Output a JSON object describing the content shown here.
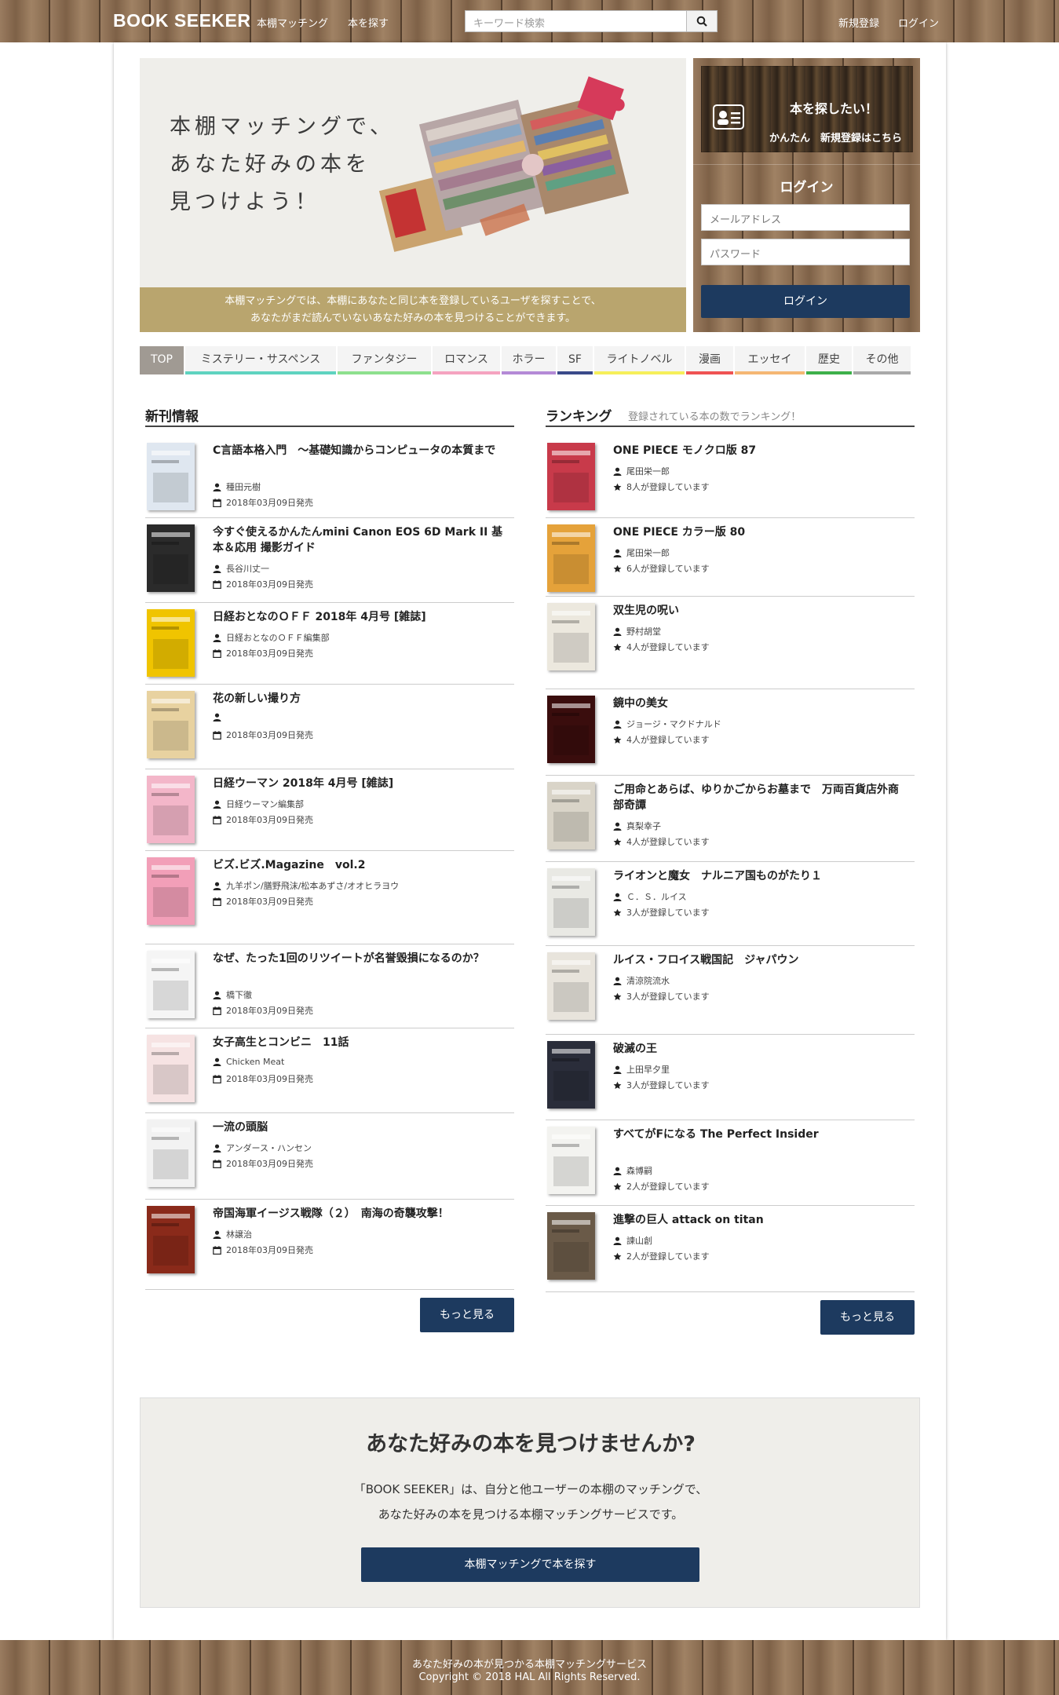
{
  "header": {
    "logo": "BOOK SEEKER",
    "nav": [
      "本棚マッチング",
      "本を探す"
    ],
    "search_placeholder": "キーワード検索",
    "register": "新規登録",
    "login": "ログイン"
  },
  "hero": {
    "title_lines": [
      "本棚マッチングで、",
      "あなた好みの本を",
      "見つけよう！"
    ],
    "bar_lines": [
      "本棚マッチングでは、本棚にあなたと同じ本を登録しているユーザを探すことで、",
      "あなたがまだ読んでいないあなた好みの本を見つけることができます。"
    ]
  },
  "side": {
    "promo_title": "本を探したい！",
    "promo_sub": "かんたん　新規登録はこちら",
    "login_title": "ログイン",
    "email_placeholder": "メールアドレス",
    "password_placeholder": "パスワード",
    "login_button": "ログイン"
  },
  "tabs": [
    {
      "label": "TOP",
      "color": "#a09a93"
    },
    {
      "label": "ミステリー・サスペンス",
      "color": "#5fd3c0"
    },
    {
      "label": "ファンタジー",
      "color": "#8ee08e"
    },
    {
      "label": "ロマンス",
      "color": "#f5a3c0"
    },
    {
      "label": "ホラー",
      "color": "#b48ad6"
    },
    {
      "label": "SF",
      "color": "#3a4a8a"
    },
    {
      "label": "ライトノベル",
      "color": "#f6ef5a"
    },
    {
      "label": "漫画",
      "color": "#ef5353"
    },
    {
      "label": "エッセイ",
      "color": "#f5b774"
    },
    {
      "label": "歴史",
      "color": "#3db04a"
    },
    {
      "label": "その他",
      "color": "#a9a9a9"
    }
  ],
  "new_releases": {
    "title": "新刊情報",
    "items": [
      {
        "title": "C言語本格入門　～基礎知識からコンピュータの本質まで",
        "author": "種田元樹",
        "date": "2018年03月09日発売",
        "cover": "#dfe7f0"
      },
      {
        "title": "今すぐ使えるかんたんmini Canon EOS 6D Mark II 基本＆応用 撮影ガイド",
        "author": "長谷川丈一",
        "date": "2018年03月09日発売",
        "cover": "#2b2b2b"
      },
      {
        "title": "日経おとなのＯＦＦ 2018年 4月号 [雑誌]",
        "author": "日経おとなのＯＦＦ編集部",
        "date": "2018年03月09日発売",
        "cover": "#f0c400"
      },
      {
        "title": "花の新しい撮り方",
        "author": "",
        "date": "2018年03月09日発売",
        "cover": "#e8d2a0"
      },
      {
        "title": "日経ウーマン 2018年 4月号 [雑誌]",
        "author": "日経ウーマン編集部",
        "date": "2018年03月09日発売",
        "cover": "#f3b6c9"
      },
      {
        "title": "ビズ.ビズ.Magazine　vol.2",
        "author": "九羊ポン/膳野飛沫/松本あずさ/オオヒラヨウ",
        "date": "2018年03月09日発売",
        "cover": "#f29fb8"
      },
      {
        "title": "なぜ、たった1回のリツイートが名誉毀損になるのか？",
        "author": "橋下徹",
        "date": "2018年03月09日発売",
        "cover": "#f5f5f5"
      },
      {
        "title": "女子高生とコンビニ　11話",
        "author": "Chicken Meat",
        "date": "2018年03月09日発売",
        "cover": "#f6e3e3"
      },
      {
        "title": "一流の頭脳",
        "author": "アンダース・ハンセン",
        "date": "2018年03月09日発売",
        "cover": "#f2f2f2"
      },
      {
        "title": "帝国海軍イージス戦隊（２）　南海の奇襲攻撃！",
        "author": "林譲治",
        "date": "2018年03月09日発売",
        "cover": "#8a2a1a"
      }
    ],
    "more": "もっと見る"
  },
  "ranking": {
    "title": "ランキング",
    "subtitle": "登録されている本の数でランキング！",
    "items": [
      {
        "title": "ONE PIECE モノクロ版 87",
        "author": "尾田栄一郎",
        "count": "8人が登録しています",
        "cover": "#c83a4a"
      },
      {
        "title": "ONE PIECE カラー版 80",
        "author": "尾田栄一郎",
        "count": "6人が登録しています",
        "cover": "#e5a23a"
      },
      {
        "title": "双生児の呪い",
        "author": "野村胡堂",
        "count": "4人が登録しています",
        "cover": "#ece8de"
      },
      {
        "title": "鏡中の美女",
        "author": "ジョージ・マクドナルド",
        "count": "4人が登録しています",
        "cover": "#3a0d0d"
      },
      {
        "title": "ご用命とあらば、ゆりかごからお墓まで　万両百貨店外商部奇譚",
        "author": "真梨幸子",
        "count": "4人が登録しています",
        "cover": "#d9d4c8"
      },
      {
        "title": "ライオンと魔女　ナルニア国ものがたり１",
        "author": "Ｃ．Ｓ．ルイス",
        "count": "3人が登録しています",
        "cover": "#e9e9e4"
      },
      {
        "title": "ルイス・フロイス戦国記　ジャパウン",
        "author": "清涼院流水",
        "count": "3人が登録しています",
        "cover": "#e8e4dc"
      },
      {
        "title": "破滅の王",
        "author": "上田早夕里",
        "count": "3人が登録しています",
        "cover": "#2a2d3a"
      },
      {
        "title": "すべてがFになる The Perfect Insider",
        "author": "森博嗣",
        "count": "2人が登録しています",
        "cover": "#f3f3f0"
      },
      {
        "title": "進撃の巨人 attack on titan",
        "author": "諫山創",
        "count": "2人が登録しています",
        "cover": "#6a5a48"
      }
    ],
    "more": "もっと見る"
  },
  "about": {
    "title": "あなた好みの本を見つけませんか?",
    "text_lines": [
      "「BOOK SEEKER」は、自分と他ユーザーの本棚のマッチングで、",
      "あなた好みの本を見つける本棚マッチングサービスです。"
    ],
    "button": "本棚マッチングで本を探す"
  },
  "footer": {
    "line1": "あなた好みの本が見つかる本棚マッチングサービス",
    "line2": "Copyright © 2018 HAL All Rights Reserved."
  }
}
